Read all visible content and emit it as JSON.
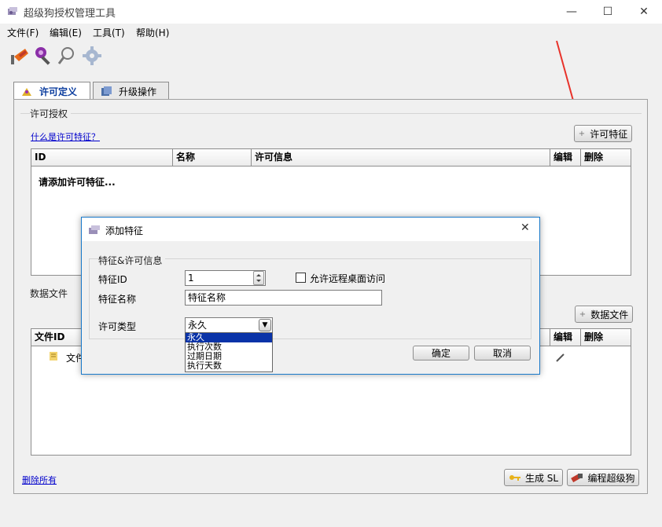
{
  "window": {
    "title": "超级狗授权管理工具",
    "minimize": "—",
    "maximize": "☐",
    "close": "✕"
  },
  "menu": {
    "items": [
      "文件(F)",
      "编辑(E)",
      "工具(T)",
      "帮助(H)"
    ]
  },
  "toolbar": {
    "icons": [
      "flame-stick-icon",
      "pin-key-icon",
      "magnifier-icon",
      "gear-icon"
    ]
  },
  "tabs": [
    {
      "label": "许可定义",
      "active": true
    },
    {
      "label": "升级操作",
      "active": false
    }
  ],
  "license_section": {
    "group_title": "许可授权",
    "help_link": "什么是许可特征？",
    "add_button": "许可特征",
    "columns": [
      "ID",
      "名称",
      "许可信息",
      "编辑",
      "删除"
    ],
    "empty_text": "请添加许可特征..."
  },
  "data_section": {
    "group_title": "数据文件",
    "add_button": "数据文件",
    "columns": [
      "文件ID",
      "编辑",
      "删除"
    ],
    "row_label": "文件"
  },
  "footer": {
    "delete_all_link": "删除所有",
    "generate_button": "生成 SL",
    "program_button": "编程超级狗"
  },
  "dialog": {
    "title": "添加特征",
    "close": "✕",
    "group_title": "特征&许可信息",
    "feature_id_label": "特征ID",
    "feature_id_value": "1",
    "remote_checkbox_label": "允许远程桌面访问",
    "feature_name_label": "特征名称",
    "feature_name_value": "特征名称",
    "license_type_label": "许可类型",
    "license_type_value": "永久",
    "license_type_options": [
      "永久",
      "执行次数",
      "过期日期",
      "执行天数"
    ],
    "ok_button": "确定",
    "cancel_button": "取消"
  },
  "colors": {
    "accent": "#1979ca",
    "link": "#0000cc",
    "selected": "#0a33a8",
    "annotation_arrow": "#e8322a"
  }
}
